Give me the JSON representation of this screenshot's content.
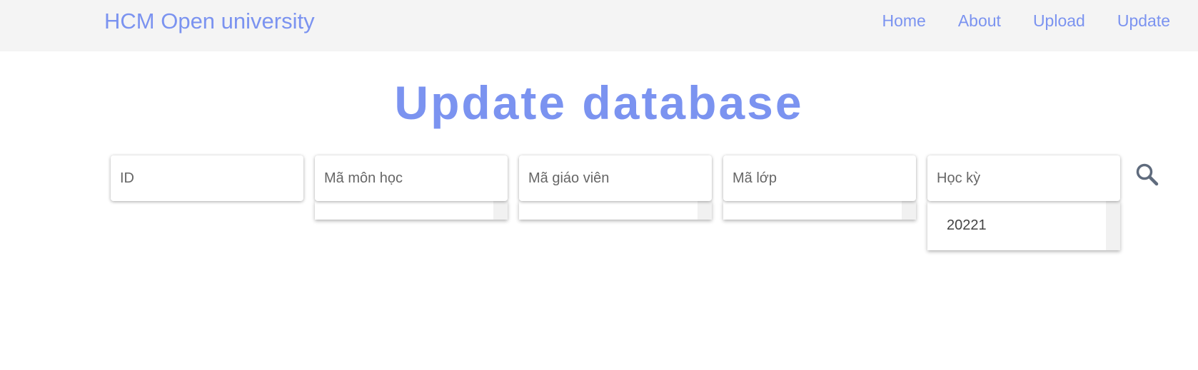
{
  "navbar": {
    "brand": "HCM Open university",
    "links": [
      "Home",
      "About",
      "Upload",
      "Update"
    ]
  },
  "main": {
    "title": "Update database"
  },
  "filters": {
    "id": {
      "placeholder": "ID",
      "value": ""
    },
    "course_code": {
      "placeholder": "Mã môn học",
      "value": ""
    },
    "teacher_code": {
      "placeholder": "Mã giáo viên",
      "value": ""
    },
    "class_code": {
      "placeholder": "Mã lớp",
      "value": ""
    },
    "semester": {
      "placeholder": "Học kỳ",
      "value": "",
      "options": [
        "20221"
      ]
    }
  },
  "icons": {
    "search": "search-icon"
  },
  "colors": {
    "accent": "#7b93f0",
    "navbar_bg": "#f4f4f4",
    "search_icon": "#5f6b7d"
  }
}
